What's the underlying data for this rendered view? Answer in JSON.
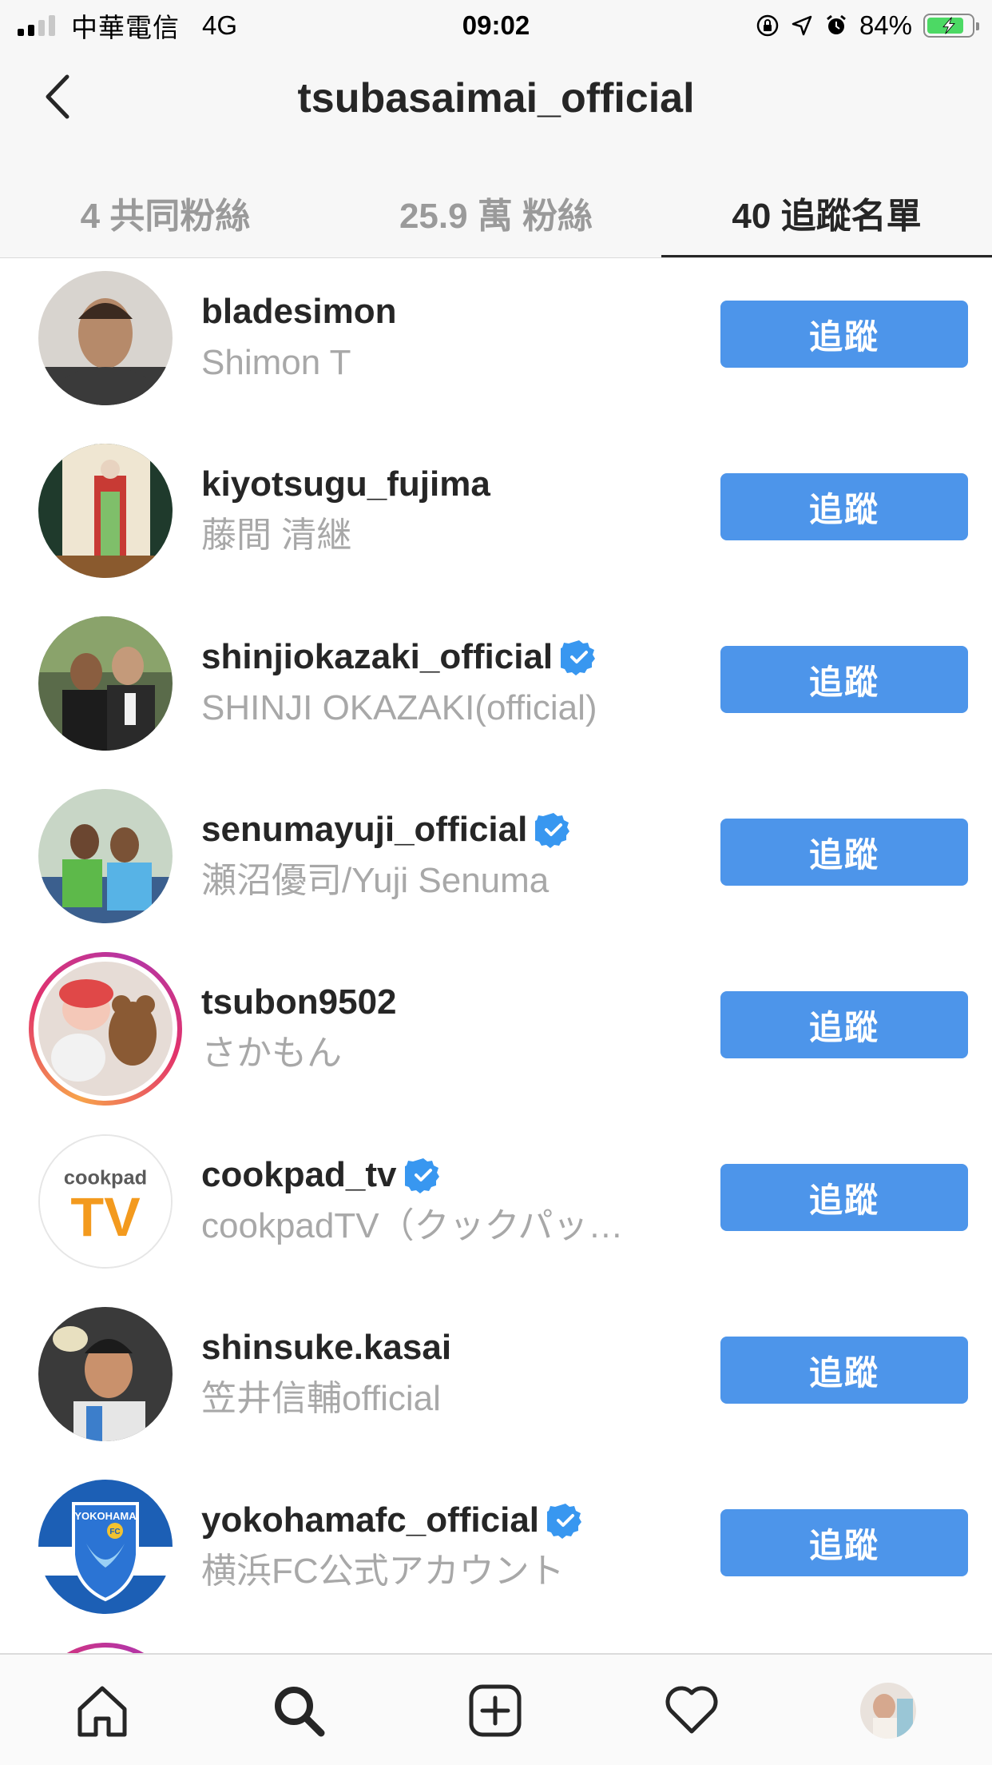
{
  "status_bar": {
    "carrier": "中華電信",
    "network": "4G",
    "time": "09:02",
    "battery_percent": "84%",
    "battery_level": 0.84,
    "icons": [
      "signal-icon",
      "orientation-lock-icon",
      "location-icon",
      "alarm-icon",
      "battery-charging-icon"
    ]
  },
  "header": {
    "title": "tsubasaimai_official",
    "back_icon": "chevron-left-icon"
  },
  "tabs": [
    {
      "label": "4 共同粉絲",
      "active": false
    },
    {
      "label": "25.9 萬 粉絲",
      "active": false
    },
    {
      "label": "40 追蹤名單",
      "active": true
    }
  ],
  "following": [
    {
      "username": "bladesimon",
      "full_name": "Shimon T",
      "verified": false,
      "button": "追蹤"
    },
    {
      "username": "kiyotsugu_fujima",
      "full_name": "藤間 清継",
      "verified": false,
      "button": "追蹤"
    },
    {
      "username": "shinjiokazaki_official",
      "full_name": "SHINJI OKAZAKI(official)",
      "verified": true,
      "button": "追蹤"
    },
    {
      "username": "senumayuji_official",
      "full_name": "瀬沼優司/Yuji Senuma",
      "verified": true,
      "button": "追蹤"
    },
    {
      "username": "tsubon9502",
      "full_name": "さかもん",
      "verified": false,
      "has_story": true,
      "button": "追蹤"
    },
    {
      "username": "cookpad_tv",
      "full_name": "cookpadTV（クックパッ…",
      "verified": true,
      "button": "追蹤",
      "logo_text": [
        "cookpad",
        "TV"
      ]
    },
    {
      "username": "shinsuke.kasai",
      "full_name": "笠井信輔official",
      "verified": false,
      "button": "追蹤"
    },
    {
      "username": "yokohamafc_official",
      "full_name": "横浜FC公式アカウント",
      "verified": true,
      "button": "追蹤",
      "logo_text": [
        "YOKOHAMA",
        "FC"
      ]
    }
  ],
  "bottom_nav": [
    "home-icon",
    "search-icon",
    "new-post-icon",
    "activity-heart-icon",
    "profile-avatar"
  ],
  "colors": {
    "follow_button": "#4d95ea",
    "verified": "#3897f0",
    "secondary_text": "#a8a8a8"
  }
}
